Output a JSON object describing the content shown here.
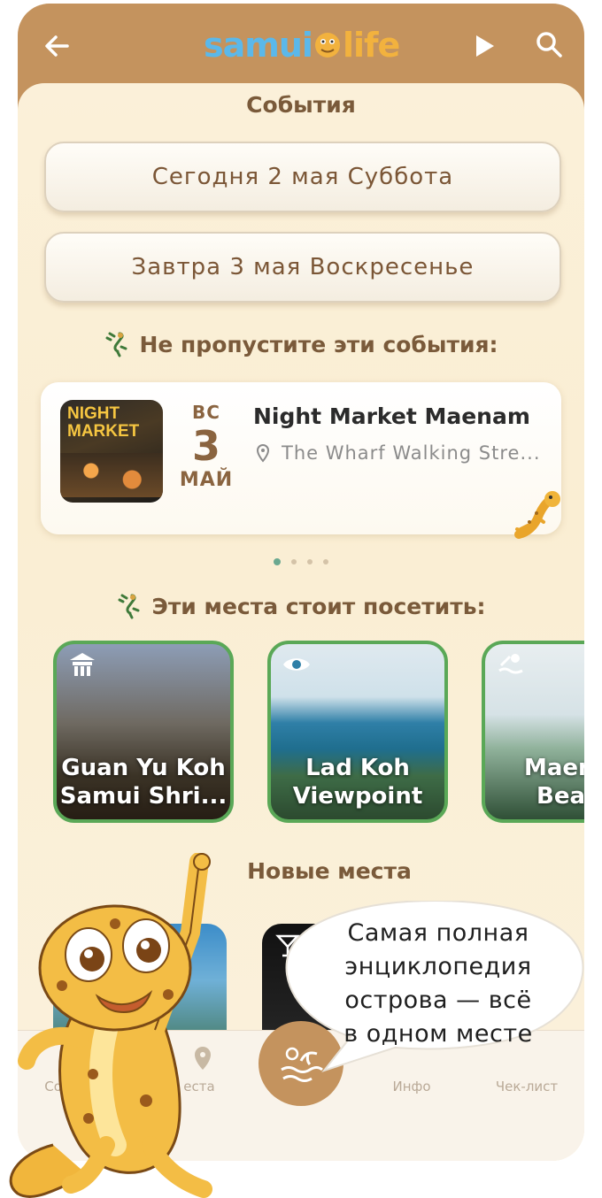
{
  "header": {
    "logo_part1": "samui",
    "logo_part2": "life"
  },
  "events_section": {
    "title": "События",
    "today_button": "Сегодня 2 мая Суббота",
    "tomorrow_button": "Завтра 3 мая Воскресенье"
  },
  "featured_events": {
    "title": "Не пропустите эти события:",
    "items": [
      {
        "poster_text": "NIGHT MARKET",
        "day_of_week": "ВС",
        "day": "3",
        "month": "МАЙ",
        "title": "Night Market Maenam",
        "location": "The Wharf Walking Stre..."
      }
    ],
    "pagination": {
      "count": 4,
      "active_index": 0
    }
  },
  "places_section": {
    "title": "Эти места стоит посетить:",
    "items": [
      {
        "name_line1": "Guan Yu Koh",
        "name_line2": "Samui Shri...",
        "icon": "temple-icon"
      },
      {
        "name_line1": "Lad Koh",
        "name_line2": "Viewpoint",
        "icon": "eye-icon"
      },
      {
        "name_line1": "Maen",
        "name_line2": "Beac",
        "icon": "beach-icon"
      }
    ]
  },
  "new_places": {
    "title": "Новые места"
  },
  "tab_bar": {
    "items": [
      {
        "label": "Событ",
        "icon": "calendar-icon"
      },
      {
        "label": "еста",
        "icon": "map-pin-icon"
      },
      {
        "label": "",
        "icon": "island-icon"
      },
      {
        "label": "Инфо",
        "icon": "info-icon"
      },
      {
        "label": "Чек-лист",
        "icon": "checklist-icon"
      }
    ]
  },
  "promo": {
    "bubble_line1": "Самая полная",
    "bubble_line2": "энциклопедия",
    "bubble_line3": "острова — всё",
    "bubble_line4": "в одном месте"
  },
  "colors": {
    "header": "#c4935e",
    "background": "#fbeccd",
    "accent_green": "#5aa857",
    "text_brown": "#7a5a3a"
  }
}
